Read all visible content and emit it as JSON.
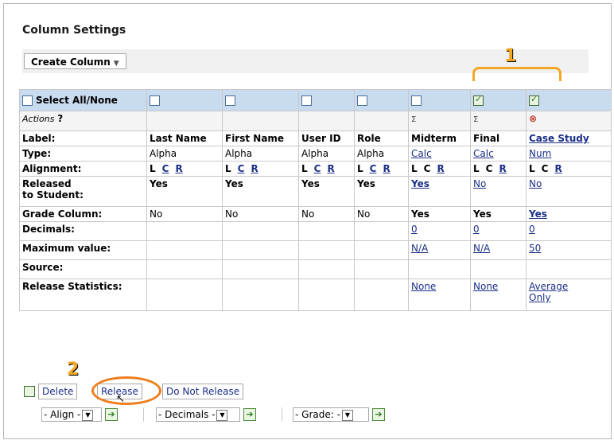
{
  "title": "Column Settings",
  "toolbar": {
    "create_label": "Create Column"
  },
  "header": {
    "select_all": "Select All/None"
  },
  "row_labels": {
    "actions": "Actions",
    "actions_help": "?",
    "label": "Label:",
    "type": "Type:",
    "alignment": "Alignment:",
    "released_1": "Released",
    "released_2": "to Student:",
    "grade_column": "Grade Column:",
    "decimals": "Decimals:",
    "max_value": "Maximum value:",
    "source": "Source:",
    "release_stats": "Release Statistics:"
  },
  "columns": [
    {
      "label": "Last Name",
      "type": "Alpha",
      "align": [
        "L",
        "C",
        "R"
      ],
      "released": "Yes",
      "grade": "No",
      "decimals": "",
      "max": "",
      "stats": ""
    },
    {
      "label": "First Name",
      "type": "Alpha",
      "align": [
        "L",
        "C",
        "R"
      ],
      "released": "Yes",
      "grade": "No",
      "decimals": "",
      "max": "",
      "stats": ""
    },
    {
      "label": "User ID",
      "type": "Alpha",
      "align": [
        "L",
        "C",
        "R"
      ],
      "released": "Yes",
      "grade": "No",
      "decimals": "",
      "max": "",
      "stats": ""
    },
    {
      "label": "Role",
      "type": "Alpha",
      "align": [
        "L",
        "C",
        "R"
      ],
      "released": "Yes",
      "grade": "No",
      "decimals": "",
      "max": "",
      "stats": ""
    },
    {
      "label": "Midterm",
      "type": "Calc",
      "align": [
        "L",
        "C",
        "R"
      ],
      "released": "Yes",
      "grade": "Yes",
      "decimals": "0",
      "max": "N/A",
      "stats": "None"
    },
    {
      "label": "Final",
      "type": "Calc",
      "align": [
        "L",
        "C",
        "R"
      ],
      "released": "No",
      "grade": "Yes",
      "decimals": "0",
      "max": "N/A",
      "stats": "None"
    },
    {
      "label": "Case Study",
      "type": "Num",
      "align": [
        "L",
        "C",
        "R"
      ],
      "released": "No",
      "grade": "Yes",
      "decimals": "0",
      "max": "50",
      "stats_1": "Average",
      "stats_2": "Only"
    }
  ],
  "bottom": {
    "delete": "Delete",
    "release": "Release",
    "do_not_release": "Do Not Release",
    "align_select": "- Align -",
    "decimals_select": "- Decimals -",
    "grade_select": "- Grade: -"
  },
  "annotations": {
    "one": "1",
    "two": "2"
  },
  "colors": {
    "header_bg": "#c9dbef",
    "annotation": "#f5a623",
    "ring": "#ee7d1c",
    "link": "#1c2f88"
  }
}
